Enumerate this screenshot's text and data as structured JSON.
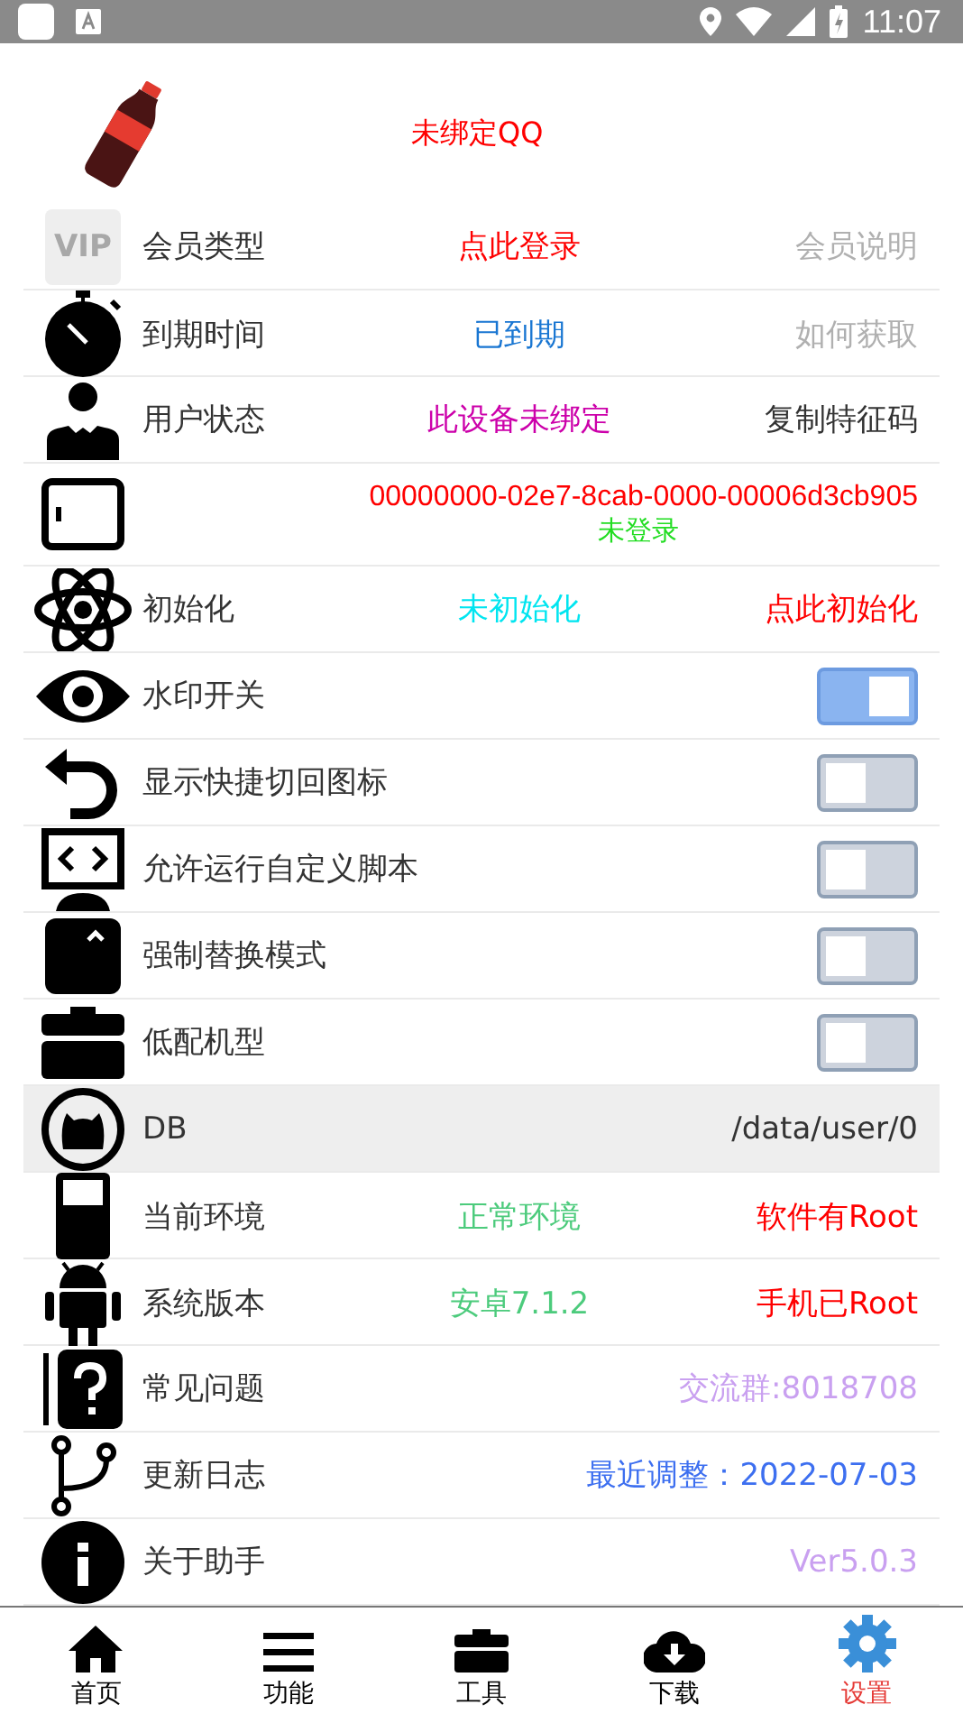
{
  "status_bar": {
    "time": "11:07"
  },
  "header": {
    "qq_status": "未绑定QQ"
  },
  "rows": [
    {
      "kind": "info",
      "badge": "VIP",
      "label": "会员类型",
      "value": {
        "text": "点此登录",
        "color": "#ff0000"
      },
      "action": {
        "text": "会员说明",
        "color": "#b0b0b0"
      }
    },
    {
      "kind": "info",
      "label": "到期时间",
      "value": {
        "text": "已到期",
        "color": "#1976d2"
      },
      "action": {
        "text": "如何获取",
        "color": "#b0b0b0"
      }
    },
    {
      "kind": "info",
      "label": "用户状态",
      "value": {
        "text": "此设备未绑定",
        "color": "#cc00aa"
      },
      "action": {
        "text": "复制特征码",
        "color": "#333333"
      }
    },
    {
      "kind": "id",
      "value": {
        "text": "00000000-02e7-8cab-0000-00006d3cb905",
        "color": "#ff0000"
      },
      "action": {
        "text": "未登录",
        "color": "#22dd22"
      }
    },
    {
      "kind": "info",
      "label": "初始化",
      "value": {
        "text": "未初始化",
        "color": "#00e5f0"
      },
      "action": {
        "text": "点此初始化",
        "color": "#ff0000"
      }
    },
    {
      "kind": "toggle",
      "label": "水印开关",
      "on": true
    },
    {
      "kind": "toggle",
      "label": "显示快捷切回图标",
      "on": false
    },
    {
      "kind": "toggle",
      "label": "允许运行自定义脚本",
      "on": false
    },
    {
      "kind": "toggle",
      "label": "强制替换模式",
      "on": false
    },
    {
      "kind": "toggle",
      "label": "低配机型",
      "on": false
    },
    {
      "kind": "path",
      "label": "DB",
      "action": {
        "text": "/data/user/0",
        "color": "#333333"
      }
    },
    {
      "kind": "info",
      "label": "当前环境",
      "value": {
        "text": "正常环境",
        "color": "#4ccb7c"
      },
      "action": {
        "text": "软件有Root",
        "color": "#ff0000"
      }
    },
    {
      "kind": "info",
      "label": "系统版本",
      "value": {
        "text": "安卓7.1.2",
        "color": "#4ccb7c"
      },
      "action": {
        "text": "手机已Root",
        "color": "#ff0000"
      }
    },
    {
      "kind": "info",
      "label": "常见问题",
      "action": {
        "text": "交流群:8018708",
        "color": "#c9a0f0"
      }
    },
    {
      "kind": "info",
      "label": "更新日志",
      "action": {
        "text": "最近调整：2022-07-03",
        "color": "#3d6ff0"
      }
    },
    {
      "kind": "info",
      "label": "关于助手",
      "action": {
        "text": "Ver5.0.3",
        "color": "#c9a0f0"
      }
    }
  ],
  "nav": [
    {
      "label": "首页",
      "selected": false
    },
    {
      "label": "功能",
      "selected": false
    },
    {
      "label": "工具",
      "selected": false
    },
    {
      "label": "下载",
      "selected": false
    },
    {
      "label": "设置",
      "selected": true
    }
  ]
}
